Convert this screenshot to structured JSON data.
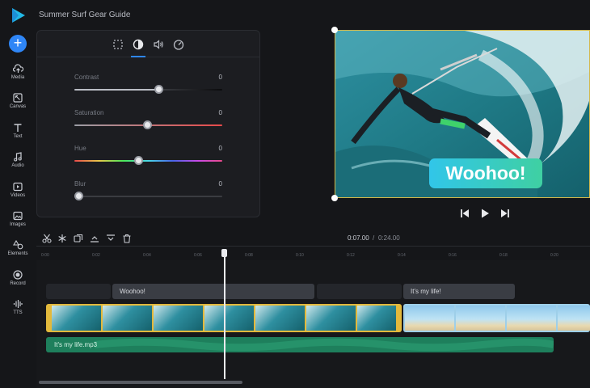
{
  "app": {
    "title": "Summer Surf Gear Guide",
    "logo_icon": "play-logo-icon",
    "accent": "#2f86f6"
  },
  "sidebar": {
    "add_icon": "plus-icon",
    "items": [
      {
        "label": "Media",
        "icon": "cloud-upload-icon"
      },
      {
        "label": "Canvas",
        "icon": "resize-icon"
      },
      {
        "label": "Text",
        "icon": "text-icon"
      },
      {
        "label": "Audio",
        "icon": "music-note-icon"
      },
      {
        "label": "Videos",
        "icon": "video-icon"
      },
      {
        "label": "Images",
        "icon": "image-icon"
      },
      {
        "label": "Elements",
        "icon": "shapes-icon"
      },
      {
        "label": "Record",
        "icon": "record-icon"
      },
      {
        "label": "TTS",
        "icon": "waveform-icon"
      }
    ]
  },
  "panel": {
    "tabs": [
      "crop-icon",
      "contrast-icon",
      "volume-icon",
      "speed-icon"
    ],
    "active_tab": 1,
    "adjustments": [
      {
        "label": "Contrast",
        "value": "0",
        "fraction": 0.57
      },
      {
        "label": "Saturation",
        "value": "0",
        "fraction": 0.49
      },
      {
        "label": "Hue",
        "value": "0",
        "fraction": 0.43
      },
      {
        "label": "Blur",
        "value": "0",
        "fraction": 0.03
      }
    ]
  },
  "preview": {
    "overlay_text": "Woohoo!"
  },
  "player": {
    "controls": [
      "skip-back-icon",
      "play-icon",
      "skip-forward-icon"
    ]
  },
  "timeline": {
    "tools": [
      "scissors-icon",
      "freeze-icon",
      "duplicate-icon",
      "split-up-icon",
      "split-down-icon",
      "trash-icon"
    ],
    "current_time": "0:07.00",
    "separator": "/",
    "total_time": "0:24.00",
    "ruler_ticks": [
      "0:00",
      "0:02",
      "0:04",
      "0:06",
      "0:08",
      "0:10",
      "0:12",
      "0:14",
      "0:16",
      "0:18",
      "0:20"
    ],
    "text_clips": [
      "Woohoo!",
      "It's my life!"
    ],
    "audio_clip": "It's my life.mp3"
  }
}
